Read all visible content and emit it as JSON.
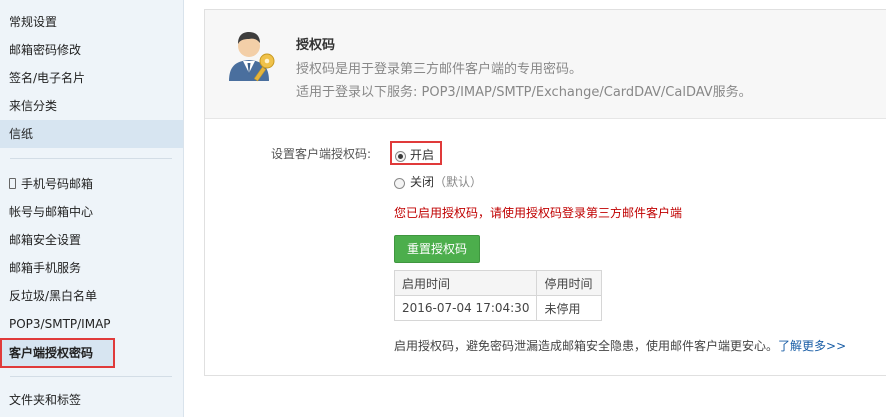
{
  "sidebar": {
    "group1": [
      "常规设置",
      "邮箱密码修改",
      "签名/电子名片",
      "来信分类",
      "信纸"
    ],
    "group2": [
      "手机号码邮箱",
      "帐号与邮箱中心",
      "邮箱安全设置",
      "邮箱手机服务",
      "反垃圾/黑白名单",
      "POP3/SMTP/IMAP",
      "客户端授权密码"
    ],
    "group3": [
      "文件夹和标签"
    ]
  },
  "header": {
    "title": "授权码",
    "desc1": "授权码是用于登录第三方邮件客户端的专用密码。",
    "desc2": "适用于登录以下服务: POP3/IMAP/SMTP/Exchange/CardDAV/CalDAV服务。"
  },
  "setting": {
    "label": "设置客户端授权码:",
    "option_on": "开启",
    "option_off": "关闭",
    "option_off_default": "（默认）",
    "selected": "开启"
  },
  "status_message": "您已启用授权码，请使用授权码登录第三方邮件客户端",
  "reset_button": "重置授权码",
  "table": {
    "headers": [
      "启用时间",
      "停用时间"
    ],
    "rows": [
      [
        "2016-07-04 17:04:30",
        "未停用"
      ]
    ]
  },
  "footer": {
    "note": "启用授权码，避免密码泄漏造成邮箱安全隐患，使用邮件客户端更安心。",
    "link": "了解更多>>"
  },
  "colors": {
    "sidebar_bg": "#eef4f9",
    "selected_bg": "#d7e5f1",
    "highlight_red": "#e03a3a",
    "button_green": "#4cae4c",
    "status_red": "#c00000",
    "link_blue": "#1a5ea6"
  },
  "icons": {
    "header": "user-with-key-icon",
    "phone": "mobile-phone-icon"
  }
}
